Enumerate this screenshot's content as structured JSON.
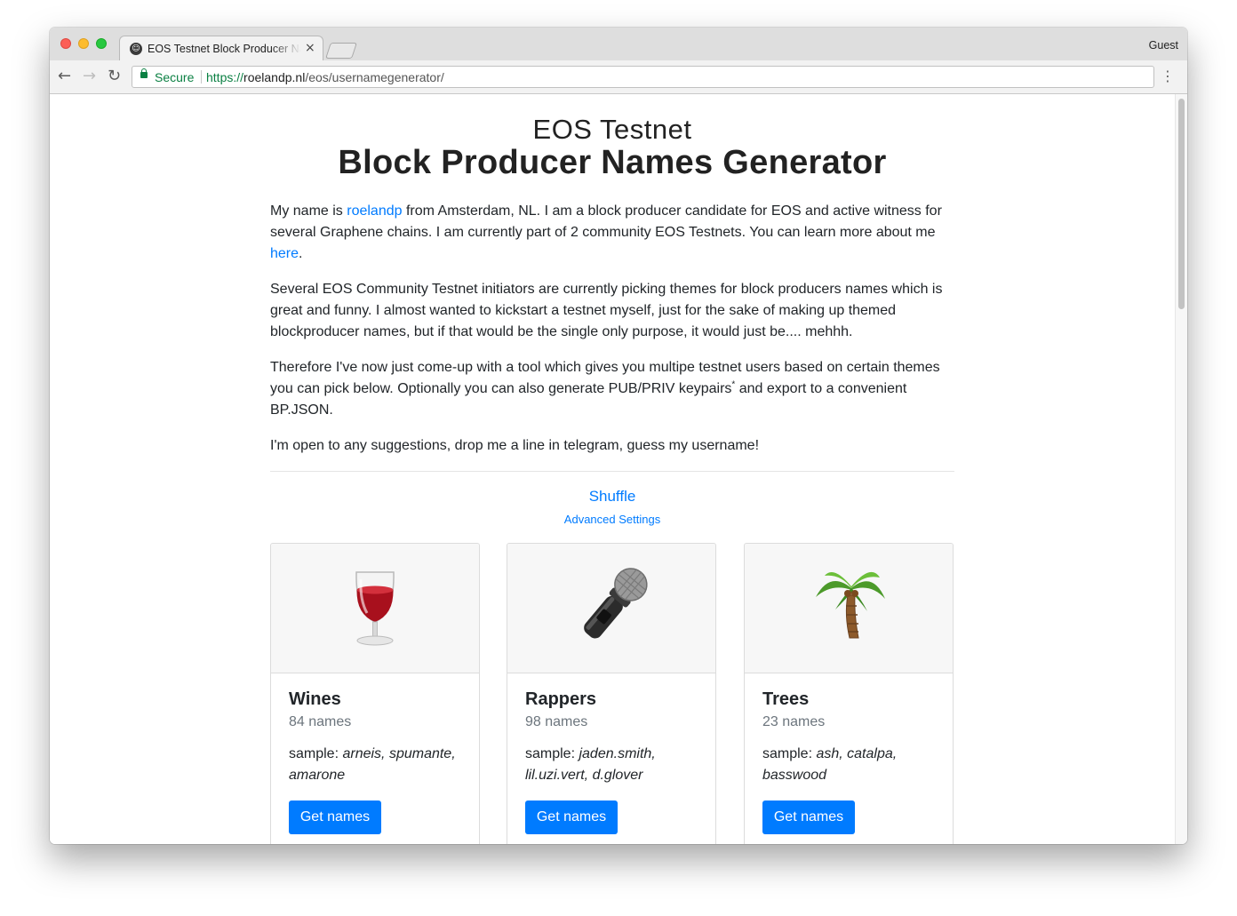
{
  "browser": {
    "tab_title": "EOS Testnet Block Producer Names Generator",
    "profile": "Guest",
    "secure_label": "Secure",
    "url_scheme": "https://",
    "url_host": "roelandp.nl",
    "url_path": "/eos/usernamegenerator/"
  },
  "page": {
    "title_small": "EOS Testnet",
    "title_big": "Block Producer Names Generator",
    "intro": {
      "p1_before": "My name is ",
      "p1_link": "roelandp",
      "p1_middle": " from Amsterdam, NL. I am a block producer candidate for EOS and active witness for several Graphene chains. I am currently part of 2 community EOS Testnets. You can learn more about me ",
      "p1_link2": "here",
      "p1_after": ".",
      "p2": "Several EOS Community Testnet initiators are currently picking themes for block producers names which is great and funny. I almost wanted to kickstart a testnet myself, just for the sake of making up themed blockproducer names, but if that would be the single only purpose, it would just be.... mehhh.",
      "p3_before": "Therefore I've now just come-up with a tool which gives you multipe testnet users based on certain themes you can pick below. Optionally you can also generate PUB/PRIV keypairs",
      "p3_sup": "*",
      "p3_after": " and export to a convenient BP.JSON.",
      "p4": "I'm open to any suggestions, drop me a line in telegram, guess my username!"
    },
    "shuffle_label": "Shuffle",
    "advanced_label": "Advanced Settings",
    "cards": [
      {
        "icon": "wine-glass-icon",
        "title": "Wines",
        "count": "84 names",
        "sample_label": "sample: ",
        "sample": "arneis, spumante, amarone",
        "button": "Get names"
      },
      {
        "icon": "microphone-icon",
        "title": "Rappers",
        "count": "98 names",
        "sample_label": "sample: ",
        "sample": "jaden.smith, lil.uzi.vert, d.glover",
        "button": "Get names"
      },
      {
        "icon": "palm-tree-icon",
        "title": "Trees",
        "count": "23 names",
        "sample_label": "sample: ",
        "sample": "ash, catalpa, basswood",
        "button": "Get names"
      }
    ]
  }
}
